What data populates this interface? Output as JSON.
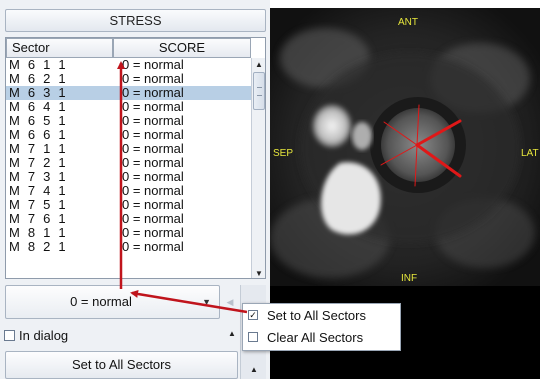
{
  "panel": {
    "title": "STRESS",
    "table": {
      "columns": [
        "Sector",
        "SCORE"
      ],
      "rows": [
        {
          "sector": "M 6 1 1",
          "score": "0 = normal",
          "selected": false
        },
        {
          "sector": "M 6 2 1",
          "score": "0 = normal",
          "selected": false
        },
        {
          "sector": "M 6 3 1",
          "score": "0 = normal",
          "selected": true
        },
        {
          "sector": "M 6 4 1",
          "score": "0 = normal",
          "selected": false
        },
        {
          "sector": "M 6 5 1",
          "score": "0 = normal",
          "selected": false
        },
        {
          "sector": "M 6 6 1",
          "score": "0 = normal",
          "selected": false
        },
        {
          "sector": "M 7 1 1",
          "score": "0 = normal",
          "selected": false
        },
        {
          "sector": "M 7 2 1",
          "score": "0 = normal",
          "selected": false
        },
        {
          "sector": "M 7 3 1",
          "score": "0 = normal",
          "selected": false
        },
        {
          "sector": "M 7 4 1",
          "score": "0 = normal",
          "selected": false
        },
        {
          "sector": "M 7 5 1",
          "score": "0 = normal",
          "selected": false
        },
        {
          "sector": "M 7 6 1",
          "score": "0 = normal",
          "selected": false
        },
        {
          "sector": "M 8 1 1",
          "score": "0 = normal",
          "selected": false
        },
        {
          "sector": "M 8 2 1",
          "score": "0 = normal",
          "selected": false
        }
      ]
    },
    "score_select": {
      "value": "0 = normal",
      "icon": "chevron-down-icon"
    },
    "in_dialog": {
      "label": "In dialog",
      "checked": false
    },
    "set_all_button": "Set to All Sectors"
  },
  "popup_menu": {
    "items": [
      {
        "label": "Set to All Sectors",
        "checked": true
      },
      {
        "label": "Clear All Sectors",
        "checked": false
      }
    ]
  },
  "viewer": {
    "orientation_labels": {
      "top": "ANT",
      "left": "SEP",
      "right": "LAT",
      "bottom": "INF"
    }
  },
  "colors": {
    "selection": "#b8cfe5",
    "annotation_arrow": "#c0141c",
    "orientation_label": "#e6e63c",
    "sector_lines": "#e01818"
  }
}
